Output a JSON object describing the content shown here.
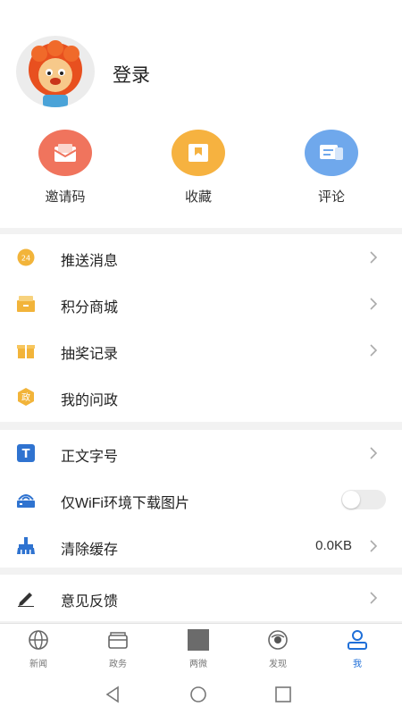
{
  "profile": {
    "login_label": "登录"
  },
  "quick_actions": [
    {
      "label": "邀请码",
      "icon": "envelope-icon",
      "color": "#f0745d"
    },
    {
      "label": "收藏",
      "icon": "bookmark-icon",
      "color": "#f6b240"
    },
    {
      "label": "评论",
      "icon": "comment-icon",
      "color": "#6fa8ec"
    }
  ],
  "menu_group_1": [
    {
      "label": "推送消息",
      "icon": "push-24h-icon"
    },
    {
      "label": "积分商城",
      "icon": "store-icon"
    },
    {
      "label": "抽奖记录",
      "icon": "gift-icon"
    },
    {
      "label": "我的问政",
      "icon": "politics-badge-icon",
      "badge_text": "政"
    }
  ],
  "menu_group_2": [
    {
      "label": "正文字号",
      "icon": "font-size-icon",
      "badge_text": "T"
    },
    {
      "label": "仅WiFi环境下载图片",
      "icon": "wifi-router-icon",
      "toggle": "off"
    },
    {
      "label": "清除缓存",
      "icon": "broom-icon",
      "value": "0.0KB"
    }
  ],
  "menu_group_3": [
    {
      "label": "意见反馈",
      "icon": "pen-icon"
    }
  ],
  "tabs": [
    {
      "label": "新闻",
      "icon": "globe-icon"
    },
    {
      "label": "政务",
      "icon": "folder-icon"
    },
    {
      "label": "两微",
      "icon": "square-icon"
    },
    {
      "label": "发现",
      "icon": "discover-icon"
    },
    {
      "label": "我",
      "icon": "user-icon",
      "active": true
    }
  ],
  "colors": {
    "accent": "#1f6fd8",
    "badge_yellow": "#f2b43a",
    "icon_blue": "#2f73d0"
  }
}
